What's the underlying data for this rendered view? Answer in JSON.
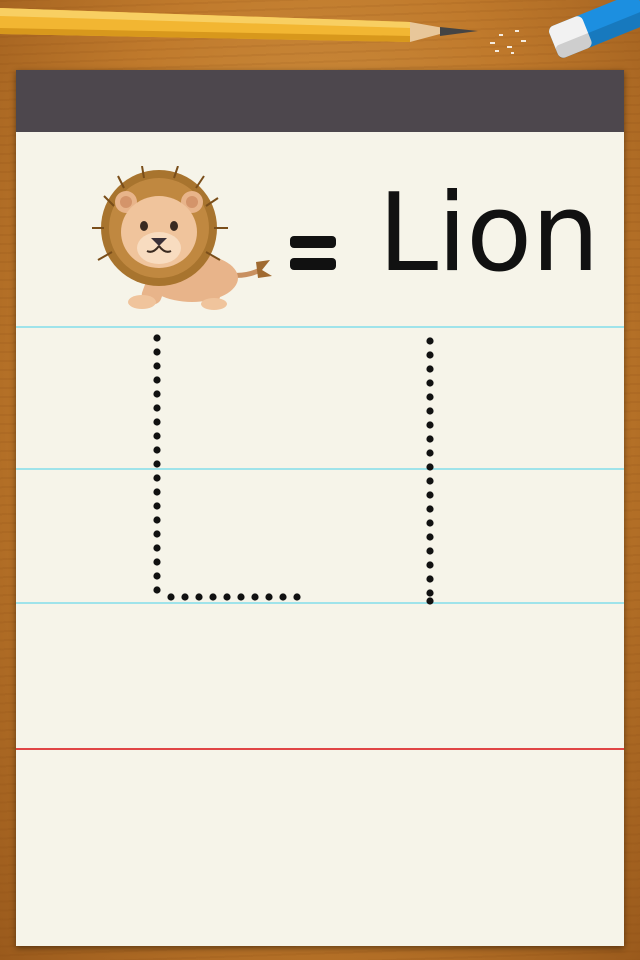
{
  "scene": {
    "background": "wooden-desk",
    "desk_items": [
      "pencil-icon",
      "eraser-icon"
    ]
  },
  "flashcard": {
    "picture": "lion-icon",
    "equals_sign": "=",
    "word": "Lion",
    "trace_letters": [
      "L",
      "i"
    ]
  },
  "colors": {
    "header": "#4d474d",
    "paper": "#f6f4e9",
    "guide_line": "#9fe3ea",
    "baseline": "#e04545",
    "ink": "#111111"
  }
}
